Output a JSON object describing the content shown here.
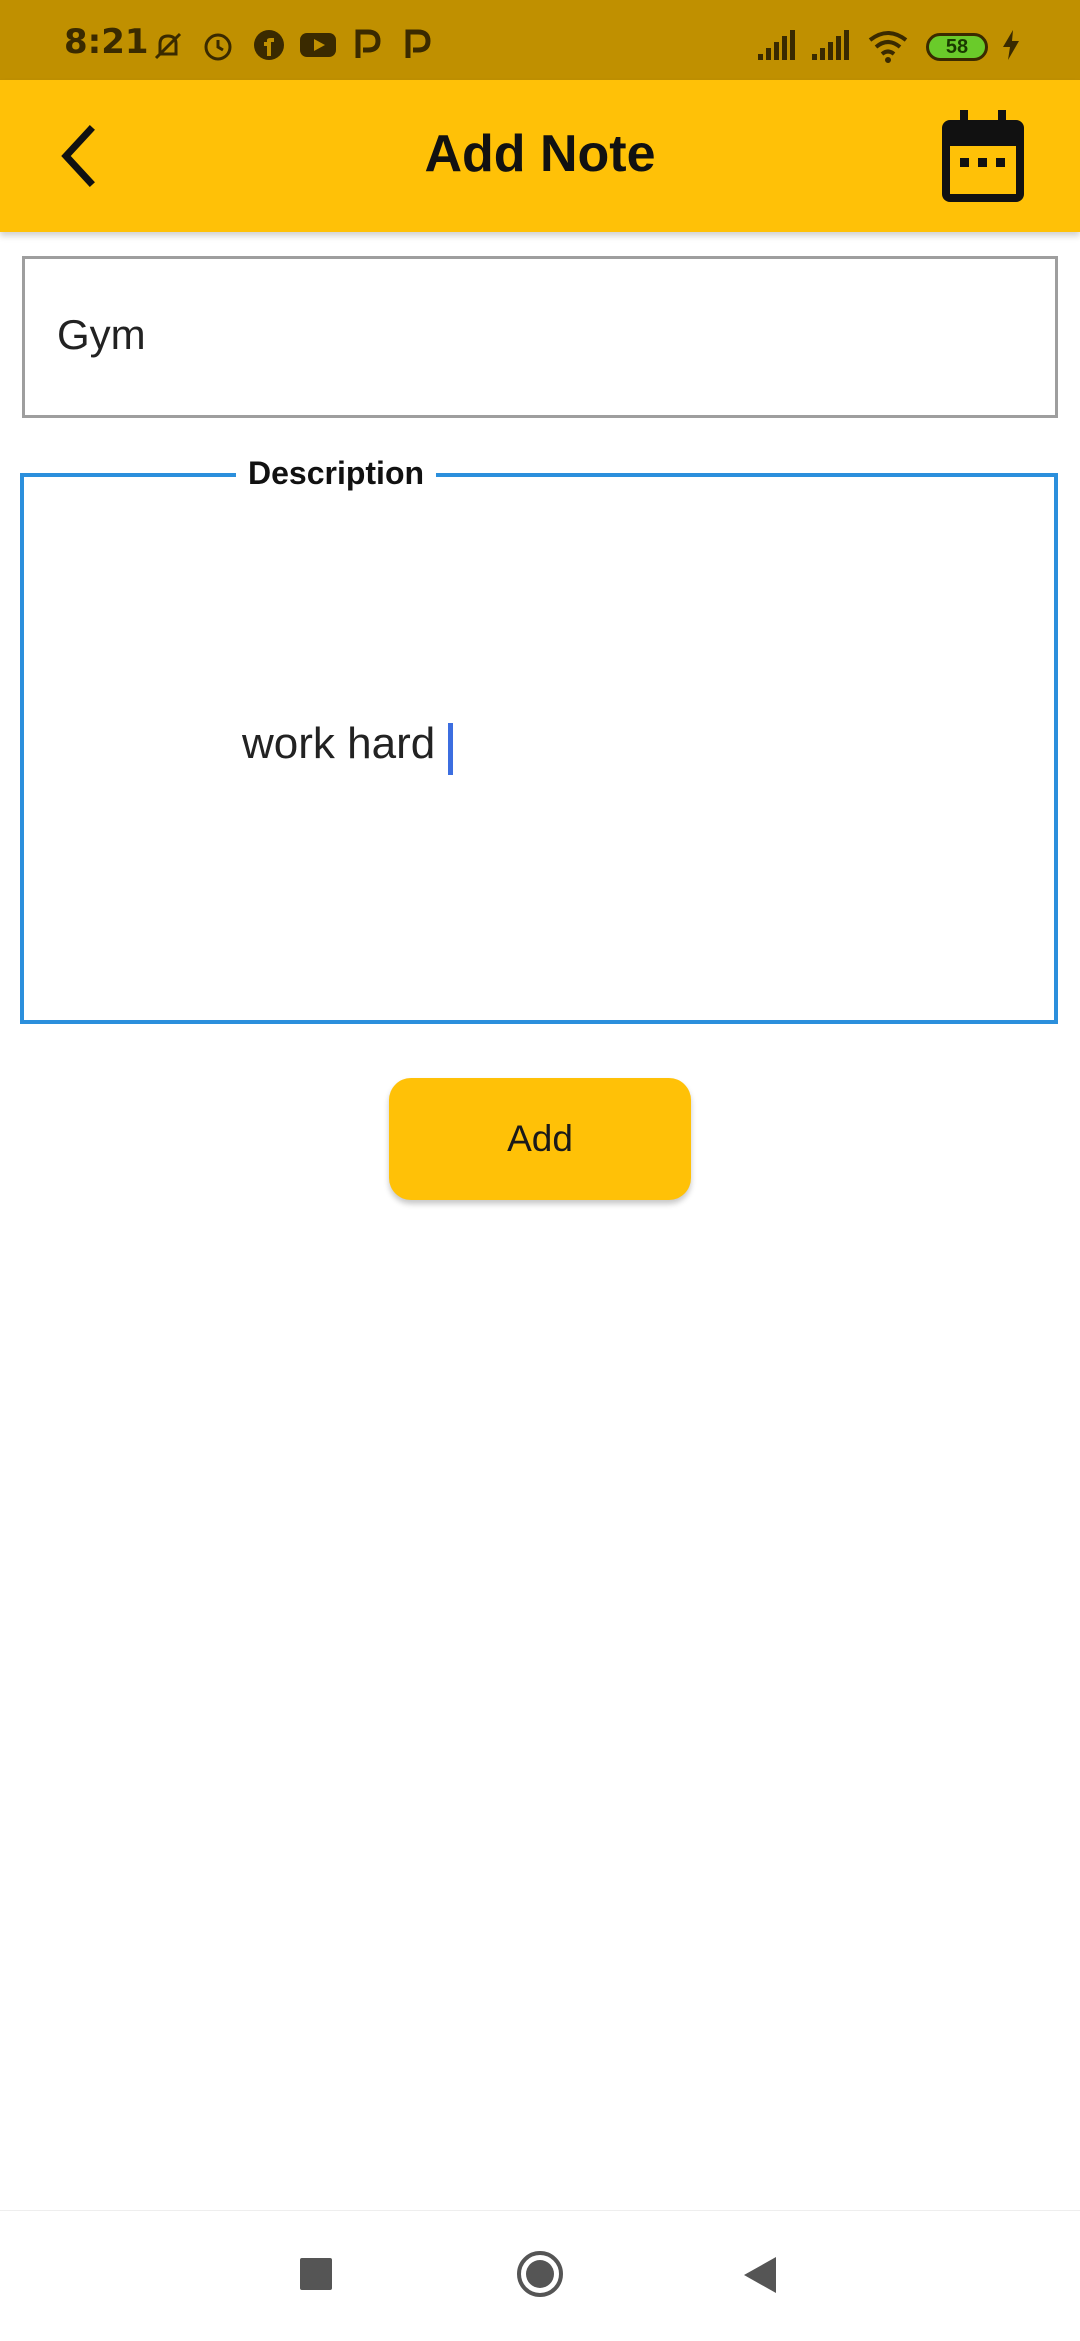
{
  "status_bar": {
    "time": "8:21",
    "battery": "58",
    "icons": [
      "mute-vibrate-icon",
      "alarm-icon",
      "facebook-icon",
      "youtube-icon",
      "p-app-icon",
      "p-app-icon",
      "signal-icon",
      "signal-icon",
      "wifi-icon",
      "battery-icon",
      "charging-icon"
    ]
  },
  "app_bar": {
    "title": "Add Note",
    "back_icon": "chevron-left-icon",
    "calendar_icon": "calendar-icon"
  },
  "form": {
    "title_value": "Gym",
    "description_label": "Description",
    "description_value": "work hard",
    "add_label": "Add"
  },
  "colors": {
    "status_bar": "#c09000",
    "app_bar": "#ffc107",
    "focus_border": "#2b8fdc",
    "button": "#ffc107"
  },
  "nav_bar": {
    "icons": [
      "recents-square-icon",
      "home-circle-icon",
      "back-triangle-icon"
    ]
  }
}
